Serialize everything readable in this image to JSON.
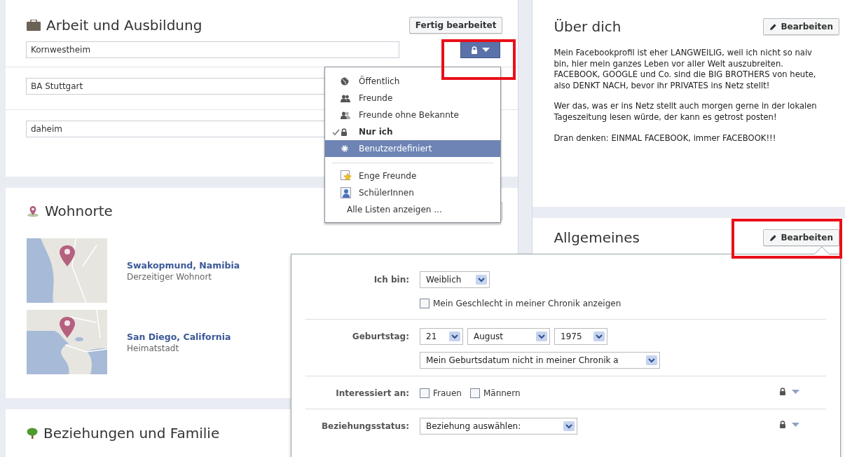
{
  "work_education": {
    "title": "Arbeit und Ausbildung",
    "done_button": "Fertig bearbeitet",
    "entries": [
      {
        "value": "Kornwestheim"
      },
      {
        "value": "BA Stuttgart"
      },
      {
        "value": "daheim"
      }
    ]
  },
  "privacy_menu": {
    "options": [
      {
        "label": "Öffentlich",
        "checked": false,
        "selected": false
      },
      {
        "label": "Freunde",
        "checked": false,
        "selected": false
      },
      {
        "label": "Freunde ohne Bekannte",
        "checked": false,
        "selected": false
      },
      {
        "label": "Nur ich",
        "checked": true,
        "selected": false
      },
      {
        "label": "Benutzerdefiniert",
        "checked": false,
        "selected": true
      }
    ],
    "lists": [
      {
        "label": "Enge Freunde"
      },
      {
        "label": "SchülerInnen"
      }
    ],
    "show_all": "Alle Listen anzeigen ..."
  },
  "places": {
    "title": "Wohnorte",
    "entries": [
      {
        "name": "Swakopmund, Namibia",
        "caption": "Derzeitiger Wohnort"
      },
      {
        "name": "San Diego, California",
        "caption": "Heimatstadt"
      }
    ]
  },
  "relations": {
    "title": "Beziehungen und Familie"
  },
  "about": {
    "title": "Über dich",
    "edit_button": "Bearbeiten",
    "paragraphs": [
      "Mein Facebookprofil ist eher LANGWEILIG, weil ich nicht so naiv bin, hier mein ganzes Leben vor aller Welt auszubreiten. FACEBOOK, GOOGLE und Co. sind die BIG BROTHERS von heute, also DENKT NACH, bevor ihr PRIVATES ins Netz stellt!",
      "Wer das, was er ins Netz stellt auch morgen gerne in der lokalen Tageszeitung lesen würde, der kann es getrost posten!",
      "Dran denken: EINMAL FACEBOOK, immer FACEBOOK!!!"
    ]
  },
  "general": {
    "title": "Allgemeines",
    "edit_button": "Bearbeiten",
    "form": [
      {
        "label": "Ich bin:",
        "privacy_lock": false,
        "lines": [
          [
            {
              "kind": "select",
              "value": "Weiblich"
            }
          ],
          [
            {
              "kind": "checkbox",
              "label": "Mein Geschlecht in meiner Chronik anzeigen",
              "checked": false
            }
          ]
        ]
      },
      {
        "label": "Geburtstag:",
        "privacy_lock": false,
        "lines": [
          [
            {
              "kind": "select",
              "value": "21"
            },
            {
              "kind": "select",
              "value": "August"
            },
            {
              "kind": "select",
              "value": "1975"
            }
          ],
          [
            {
              "kind": "select",
              "value": "Mein Geburtsdatum nicht in meiner Chronik a"
            }
          ]
        ]
      },
      {
        "label": "Interessiert an:",
        "privacy_lock": true,
        "lines": [
          [
            {
              "kind": "checkbox",
              "label": "Frauen",
              "checked": false
            },
            {
              "kind": "checkbox",
              "label": "Männern",
              "checked": false
            }
          ]
        ]
      },
      {
        "label": "Beziehungsstatus:",
        "privacy_lock": true,
        "lines": [
          [
            {
              "kind": "select",
              "value": "Beziehung auswählen:"
            }
          ]
        ]
      }
    ]
  }
}
